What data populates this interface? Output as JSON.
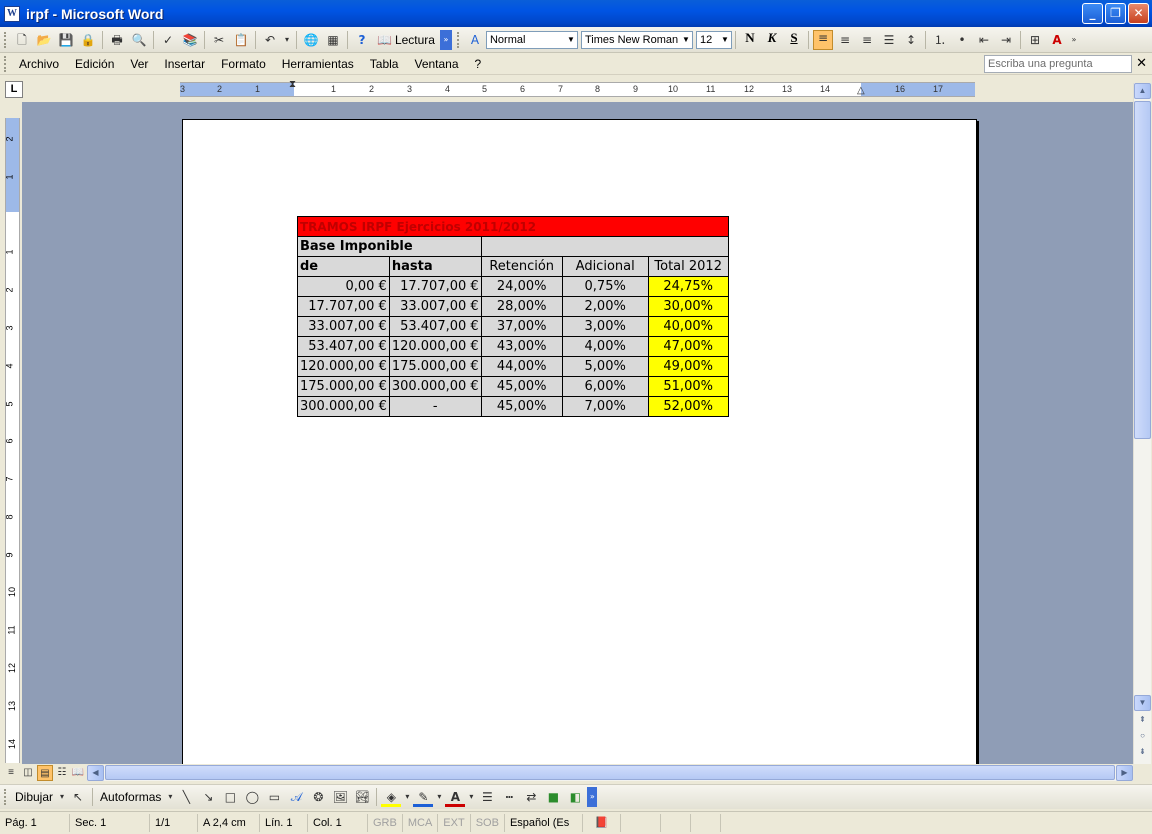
{
  "window": {
    "title": "irpf - Microsoft Word",
    "minimize": "_",
    "restore": "❐",
    "close": "✕"
  },
  "toolbar": {
    "lectura_label": "Lectura",
    "style_value": "Normal",
    "font_value": "Times New Roman",
    "size_value": "12",
    "bold_label": "N",
    "italic_label": "K",
    "underline_label": "S"
  },
  "menu": {
    "items": [
      "Archivo",
      "Edición",
      "Ver",
      "Insertar",
      "Formato",
      "Herramientas",
      "Tabla",
      "Ventana",
      "?"
    ],
    "ask_placeholder": "Escriba una pregunta",
    "close_doc": "✕"
  },
  "ruler": {
    "tab_selector": "L",
    "h_numbers": [
      "3",
      "2",
      "1",
      "1",
      "2",
      "3",
      "4",
      "5",
      "6",
      "7",
      "8",
      "9",
      "10",
      "11",
      "12",
      "13",
      "14",
      "16",
      "17"
    ],
    "v_numbers": [
      "2",
      "1",
      "1",
      "2",
      "3",
      "4",
      "5",
      "6",
      "7",
      "8",
      "9",
      "10",
      "11",
      "12",
      "13",
      "14"
    ]
  },
  "table": {
    "title": "TRAMOS IRPF Ejercicios 2011/2012",
    "base_label": "Base Imponible",
    "headers": [
      "de",
      "hasta",
      "Retención",
      "Adicional",
      "Total 2012"
    ],
    "rows": [
      [
        "0,00 €",
        "17.707,00 €",
        "24,00%",
        "0,75%",
        "24,75%"
      ],
      [
        "17.707,00 €",
        "33.007,00 €",
        "28,00%",
        "2,00%",
        "30,00%"
      ],
      [
        "33.007,00 €",
        "53.407,00 €",
        "37,00%",
        "3,00%",
        "40,00%"
      ],
      [
        "53.407,00 €",
        "120.000,00 €",
        "43,00%",
        "4,00%",
        "47,00%"
      ],
      [
        "120.000,00 €",
        "175.000,00 €",
        "44,00%",
        "5,00%",
        "49,00%"
      ],
      [
        "175.000,00 €",
        "300.000,00 €",
        "45,00%",
        "6,00%",
        "51,00%"
      ],
      [
        "300.000,00 €",
        "-",
        "45,00%",
        "7,00%",
        "52,00%"
      ]
    ]
  },
  "drawbar": {
    "draw_label": "Dibujar",
    "autoshapes_label": "Autoformas"
  },
  "status": {
    "page": "Pág. 1",
    "section": "Sec. 1",
    "pages": "1/1",
    "at": "A  2,4 cm",
    "line": "Lín. 1",
    "col": "Col. 1",
    "rec": "GRB",
    "trk": "MCA",
    "ext": "EXT",
    "ovr": "SOB",
    "lang": "Español (Es"
  },
  "colors": {
    "header_red": "#ff0000",
    "total_yellow": "#ffff00",
    "cell_gray": "#d9d9d9",
    "workspace": "#8f9db6"
  }
}
